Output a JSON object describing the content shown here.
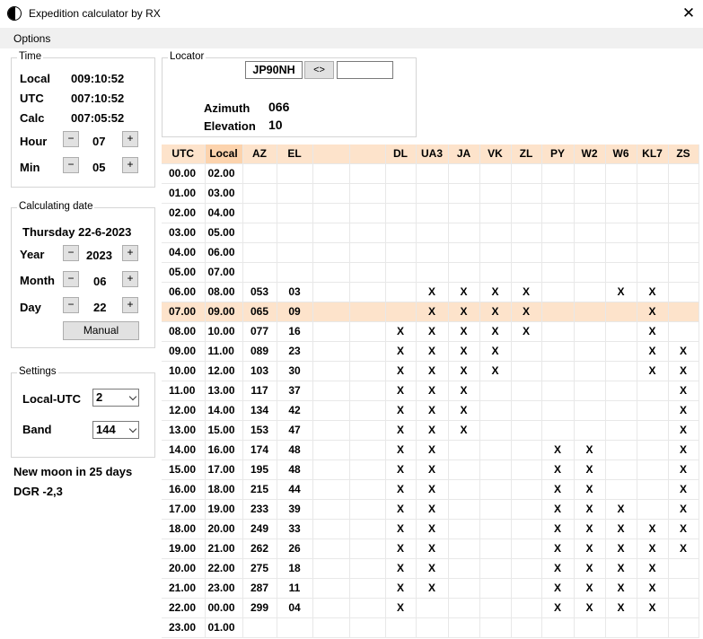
{
  "window": {
    "title": "Expedition calculator by RX",
    "close_glyph": "✕",
    "icon": "half-moon-icon"
  },
  "menu": {
    "options": "Options"
  },
  "time": {
    "title": "Time",
    "local_label": "Local",
    "local_value": "009:10:52",
    "utc_label": "UTC",
    "utc_value": "007:10:52",
    "calc_label": "Calc",
    "calc_value": "007:05:52",
    "hour_label": "Hour",
    "hour_value": "07",
    "min_label": "Min",
    "min_value": "05",
    "minus": "−",
    "plus": "+"
  },
  "date": {
    "title": "Calculating date",
    "full": "Thursday 22-6-2023",
    "year_label": "Year",
    "year_value": "2023",
    "month_label": "Month",
    "month_value": "06",
    "day_label": "Day",
    "day_value": "22",
    "manual": "Manual"
  },
  "settings": {
    "title": "Settings",
    "local_utc_label": "Local-UTC",
    "local_utc_value": "2",
    "band_label": "Band",
    "band_value": "144"
  },
  "status": {
    "moon": "New moon in 25 days",
    "dgr": "DGR -2,3"
  },
  "locator": {
    "title": "Locator",
    "value": "JP90NH",
    "swap": "<>",
    "second_value": "",
    "azimuth_label": "Azimuth",
    "azimuth_value": "066",
    "elevation_label": "Elevation",
    "elevation_value": "10"
  },
  "table": {
    "headers": [
      "UTC",
      "Local",
      "AZ",
      "EL",
      "",
      "",
      "DL",
      "UA3",
      "JA",
      "VK",
      "ZL",
      "PY",
      "W2",
      "W6",
      "KL7",
      "ZS"
    ],
    "highlight_row": 7,
    "rows": [
      [
        "00.00",
        "02.00",
        "",
        "",
        "",
        "",
        "",
        "",
        "",
        "",
        "",
        "",
        "",
        "",
        "",
        ""
      ],
      [
        "01.00",
        "03.00",
        "",
        "",
        "",
        "",
        "",
        "",
        "",
        "",
        "",
        "",
        "",
        "",
        "",
        ""
      ],
      [
        "02.00",
        "04.00",
        "",
        "",
        "",
        "",
        "",
        "",
        "",
        "",
        "",
        "",
        "",
        "",
        "",
        ""
      ],
      [
        "03.00",
        "05.00",
        "",
        "",
        "",
        "",
        "",
        "",
        "",
        "",
        "",
        "",
        "",
        "",
        "",
        ""
      ],
      [
        "04.00",
        "06.00",
        "",
        "",
        "",
        "",
        "",
        "",
        "",
        "",
        "",
        "",
        "",
        "",
        "",
        ""
      ],
      [
        "05.00",
        "07.00",
        "",
        "",
        "",
        "",
        "",
        "",
        "",
        "",
        "",
        "",
        "",
        "",
        "",
        ""
      ],
      [
        "06.00",
        "08.00",
        "053",
        "03",
        "",
        "",
        "",
        "X",
        "X",
        "X",
        "X",
        "",
        "",
        "X",
        "X",
        ""
      ],
      [
        "07.00",
        "09.00",
        "065",
        "09",
        "",
        "",
        "",
        "X",
        "X",
        "X",
        "X",
        "",
        "",
        "",
        "X",
        ""
      ],
      [
        "08.00",
        "10.00",
        "077",
        "16",
        "",
        "",
        "X",
        "X",
        "X",
        "X",
        "X",
        "",
        "",
        "",
        "X",
        ""
      ],
      [
        "09.00",
        "11.00",
        "089",
        "23",
        "",
        "",
        "X",
        "X",
        "X",
        "X",
        "",
        "",
        "",
        "",
        "X",
        "X"
      ],
      [
        "10.00",
        "12.00",
        "103",
        "30",
        "",
        "",
        "X",
        "X",
        "X",
        "X",
        "",
        "",
        "",
        "",
        "X",
        "X"
      ],
      [
        "11.00",
        "13.00",
        "117",
        "37",
        "",
        "",
        "X",
        "X",
        "X",
        "",
        "",
        "",
        "",
        "",
        "",
        "X"
      ],
      [
        "12.00",
        "14.00",
        "134",
        "42",
        "",
        "",
        "X",
        "X",
        "X",
        "",
        "",
        "",
        "",
        "",
        "",
        "X"
      ],
      [
        "13.00",
        "15.00",
        "153",
        "47",
        "",
        "",
        "X",
        "X",
        "X",
        "",
        "",
        "",
        "",
        "",
        "",
        "X"
      ],
      [
        "14.00",
        "16.00",
        "174",
        "48",
        "",
        "",
        "X",
        "X",
        "",
        "",
        "",
        "X",
        "X",
        "",
        "",
        "X"
      ],
      [
        "15.00",
        "17.00",
        "195",
        "48",
        "",
        "",
        "X",
        "X",
        "",
        "",
        "",
        "X",
        "X",
        "",
        "",
        "X"
      ],
      [
        "16.00",
        "18.00",
        "215",
        "44",
        "",
        "",
        "X",
        "X",
        "",
        "",
        "",
        "X",
        "X",
        "",
        "",
        "X"
      ],
      [
        "17.00",
        "19.00",
        "233",
        "39",
        "",
        "",
        "X",
        "X",
        "",
        "",
        "",
        "X",
        "X",
        "X",
        "",
        "X"
      ],
      [
        "18.00",
        "20.00",
        "249",
        "33",
        "",
        "",
        "X",
        "X",
        "",
        "",
        "",
        "X",
        "X",
        "X",
        "X",
        "X"
      ],
      [
        "19.00",
        "21.00",
        "262",
        "26",
        "",
        "",
        "X",
        "X",
        "",
        "",
        "",
        "X",
        "X",
        "X",
        "X",
        "X"
      ],
      [
        "20.00",
        "22.00",
        "275",
        "18",
        "",
        "",
        "X",
        "X",
        "",
        "",
        "",
        "X",
        "X",
        "X",
        "X",
        ""
      ],
      [
        "21.00",
        "23.00",
        "287",
        "11",
        "",
        "",
        "X",
        "X",
        "",
        "",
        "",
        "X",
        "X",
        "X",
        "X",
        ""
      ],
      [
        "22.00",
        "00.00",
        "299",
        "04",
        "",
        "",
        "X",
        "",
        "",
        "",
        "",
        "X",
        "X",
        "X",
        "X",
        ""
      ],
      [
        "23.00",
        "01.00",
        "",
        "",
        "",
        "",
        "",
        "",
        "",
        "",
        "",
        "",
        "",
        "",
        "",
        ""
      ]
    ]
  }
}
